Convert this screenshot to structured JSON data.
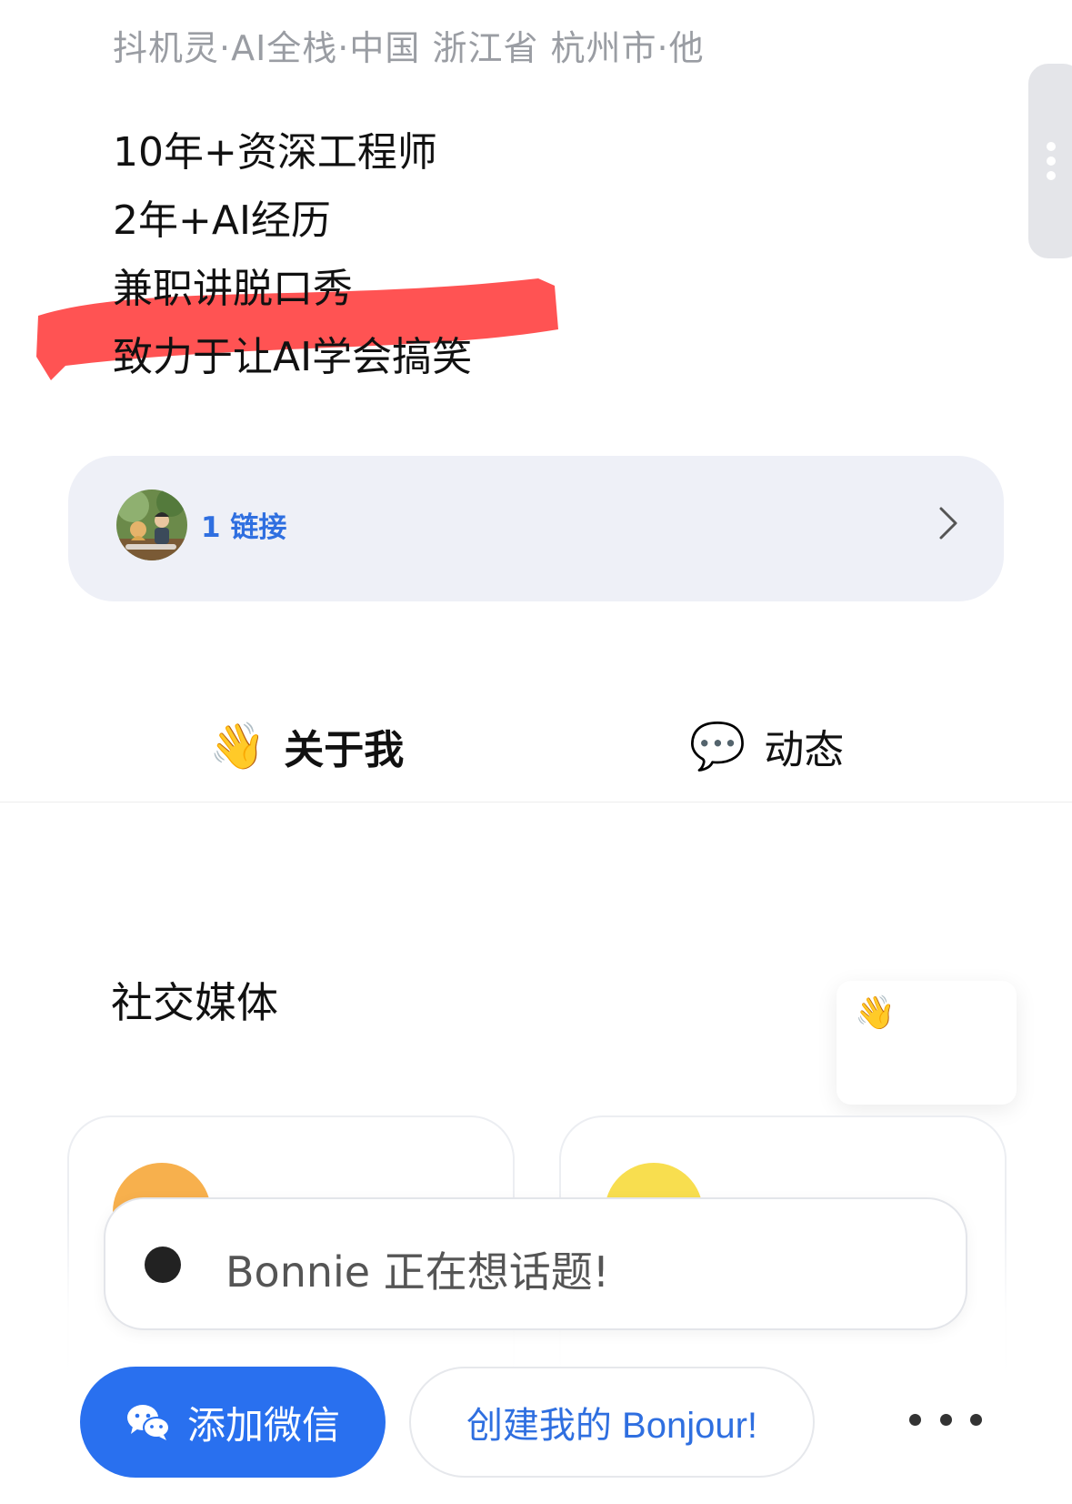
{
  "profile": {
    "meta_line": "抖机灵·AI全栈·中国 浙江省 杭州市·他",
    "bio": [
      "10年+资深工程师",
      "2年+AI经历",
      "兼职讲脱口秀",
      "致力于让AI学会搞笑"
    ]
  },
  "links_card": {
    "label": "1 链接",
    "avatar_icon": "avatar-illustration",
    "chevron_icon": "chevron-right-icon"
  },
  "tabs": [
    {
      "emoji": "👋",
      "label": "关于我"
    },
    {
      "emoji": "💬",
      "label": "动态"
    }
  ],
  "section": {
    "title": "社交媒体"
  },
  "popup": {
    "icon": "👋"
  },
  "thinking": {
    "text": "Bonnie 正在想话题!"
  },
  "actions": {
    "wechat_label": "添加微信",
    "create_label": "创建我的 Bonjour!",
    "more_icon": "more-horizontal-icon"
  },
  "colors": {
    "accent": "#2970ef",
    "highlight": "#ff4d4d",
    "card_bg": "#eef0f7"
  }
}
